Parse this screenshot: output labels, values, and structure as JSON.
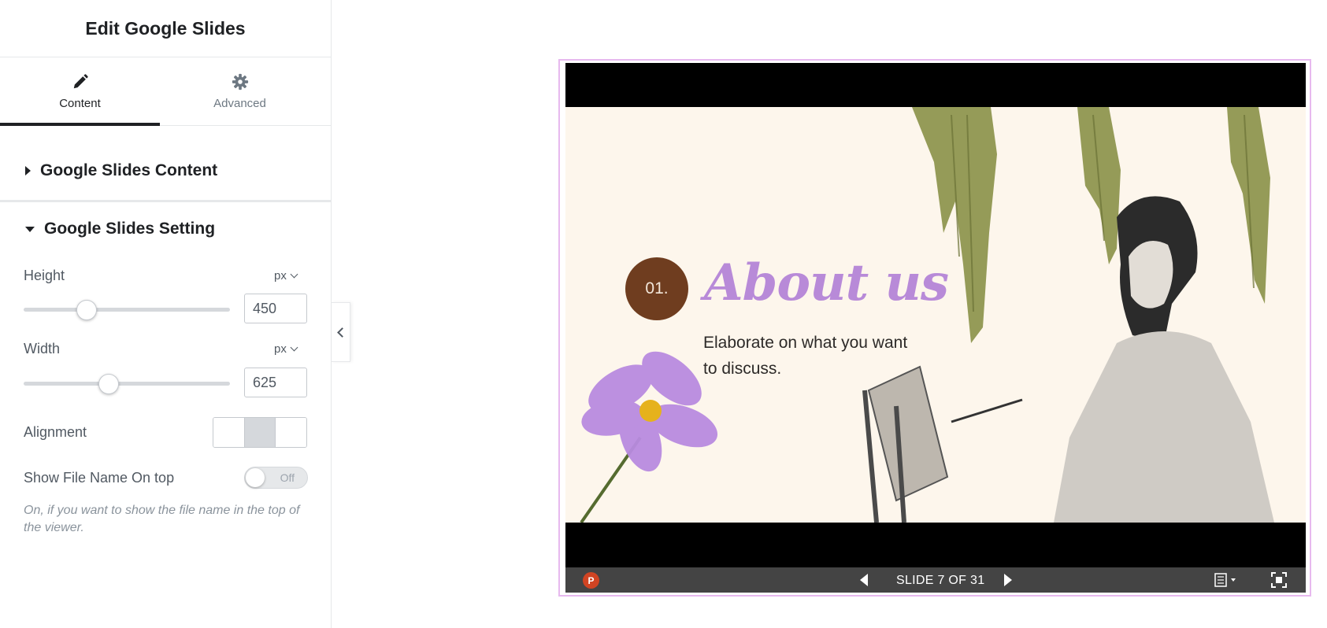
{
  "panel": {
    "title": "Edit Google Slides",
    "tabs": [
      {
        "label": "Content",
        "icon": "pencil-icon",
        "active": true
      },
      {
        "label": "Advanced",
        "icon": "gear-icon",
        "active": false
      }
    ],
    "sections": {
      "content": {
        "label": "Google Slides Content",
        "expanded": false
      },
      "setting": {
        "label": "Google Slides Setting",
        "expanded": true
      }
    },
    "height": {
      "label": "Height",
      "unit": "px",
      "value": "450",
      "level": 0.3
    },
    "width": {
      "label": "Width",
      "unit": "px",
      "value": "625",
      "level": 0.41
    },
    "alignment": {
      "label": "Alignment",
      "selected_index": 1,
      "options_count": 3
    },
    "show_file_name": {
      "label": "Show File Name On top",
      "state": "Off"
    },
    "help_text": "On, if you want to show the file name in the top of the viewer."
  },
  "preview": {
    "badge": "01.",
    "slide_title": "About us",
    "slide_body": "Elaborate on what you want to discuss.",
    "counter": "SLIDE 7 OF 31",
    "app_icon": "powerpoint-icon",
    "accent_color": "#b88ad8",
    "badge_color": "#6f3d1f",
    "frame_color": "#e7b9ef"
  }
}
